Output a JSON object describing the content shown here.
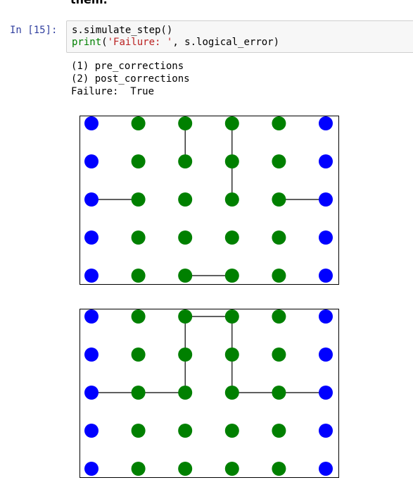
{
  "previous_cell_tail": "them.",
  "cell": {
    "prompt": "In [15]:",
    "code": {
      "line1": "s.simulate_step()",
      "line2_fn": "print",
      "line2_open": "(",
      "line2_str": "'Failure: '",
      "line2_rest": ", s.logical_error)"
    },
    "output_lines": [
      "(1) pre_corrections",
      "(2) post_corrections",
      "Failure:  True"
    ]
  },
  "colors": {
    "boundary_node": "#0000ff",
    "bulk_node": "#008000",
    "edge": "#000000"
  },
  "chart_data": [
    {
      "type": "graph",
      "grid": {
        "columns": 6,
        "rows": 5
      },
      "boundary_columns": [
        0,
        5
      ],
      "edges": [
        [
          [
            2,
            0
          ],
          [
            2,
            1
          ]
        ],
        [
          [
            3,
            0
          ],
          [
            3,
            1
          ]
        ],
        [
          [
            3,
            1
          ],
          [
            3,
            2
          ]
        ],
        [
          [
            0,
            2
          ],
          [
            1,
            2
          ]
        ],
        [
          [
            4,
            2
          ],
          [
            5,
            2
          ]
        ],
        [
          [
            2,
            4
          ],
          [
            3,
            4
          ]
        ]
      ]
    },
    {
      "type": "graph",
      "grid": {
        "columns": 6,
        "rows": 5
      },
      "boundary_columns": [
        0,
        5
      ],
      "edges": [
        [
          [
            2,
            0
          ],
          [
            3,
            0
          ]
        ],
        [
          [
            2,
            0
          ],
          [
            2,
            1
          ]
        ],
        [
          [
            2,
            1
          ],
          [
            2,
            2
          ]
        ],
        [
          [
            3,
            0
          ],
          [
            3,
            1
          ]
        ],
        [
          [
            3,
            1
          ],
          [
            3,
            2
          ]
        ],
        [
          [
            0,
            2
          ],
          [
            1,
            2
          ]
        ],
        [
          [
            1,
            2
          ],
          [
            2,
            2
          ]
        ],
        [
          [
            3,
            2
          ],
          [
            4,
            2
          ]
        ],
        [
          [
            4,
            2
          ],
          [
            5,
            2
          ]
        ]
      ]
    }
  ]
}
